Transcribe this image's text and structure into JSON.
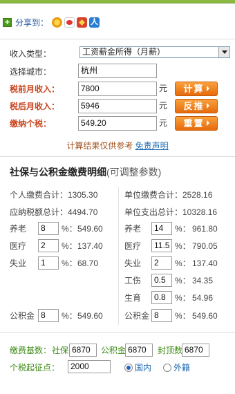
{
  "share": {
    "label": "分享到：",
    "icons": [
      "qzone-icon",
      "weibo-icon",
      "renren-icon",
      "kaixin-icon"
    ]
  },
  "form": {
    "income_type": {
      "label": "收入类型：",
      "value": "工资薪金所得（月薪）"
    },
    "city": {
      "label": "选择城市：",
      "value": "杭州"
    },
    "pretax": {
      "label": "税前月收入：",
      "value": "7800",
      "unit": "元",
      "button": "计算"
    },
    "aftertax": {
      "label": "税后月收入：",
      "value": "5946",
      "unit": "元",
      "button": "反推"
    },
    "tax": {
      "label": "缴纳个税：",
      "value": "549.20",
      "unit": "元",
      "button": "重置"
    }
  },
  "note": {
    "text": "计算结果仅供参考 ",
    "link": "免责声明"
  },
  "detail": {
    "title": "社保与公积金缴费明细",
    "subtitle": "(可调整参数)",
    "personal": {
      "total": "个人缴费合计：1305.30",
      "taxable": "应纳税额总计：4494.70",
      "rows": [
        {
          "name": "养老",
          "rate": "8",
          "pct": "%：",
          "amount": "549.60"
        },
        {
          "name": "医疗",
          "rate": "2",
          "pct": "%：",
          "amount": "137.40"
        },
        {
          "name": "失业",
          "rate": "1",
          "pct": "%：",
          "amount": "68.70"
        }
      ],
      "fund": {
        "name": "公积金",
        "rate": "8",
        "pct": "%：",
        "amount": "549.60"
      }
    },
    "company": {
      "total": "单位缴费合计：2528.16",
      "expense": "单位支出总计：10328.16",
      "rows": [
        {
          "name": "养老",
          "rate": "14",
          "pct": "%：",
          "amount": "961.80"
        },
        {
          "name": "医疗",
          "rate": "11.5",
          "pct": "%：",
          "amount": "790.05"
        },
        {
          "name": "失业",
          "rate": "2",
          "pct": "%：",
          "amount": "137.40"
        },
        {
          "name": "工伤",
          "rate": "0.5",
          "pct": "%：",
          "amount": "34.35"
        },
        {
          "name": "生育",
          "rate": "0.8",
          "pct": "%：",
          "amount": "54.96"
        }
      ],
      "fund": {
        "name": "公积金",
        "rate": "8",
        "pct": "%：",
        "amount": "549.60"
      }
    }
  },
  "base": {
    "label": "缴费基数：",
    "social_label": "社保",
    "social_value": "6870",
    "fund_label": "公积金",
    "fund_value": "6870",
    "cap_label": "封顶数",
    "cap_value": "6870"
  },
  "threshold": {
    "label": "个税起征点：",
    "value": "2000",
    "domestic": "国内",
    "foreign": "外籍"
  }
}
